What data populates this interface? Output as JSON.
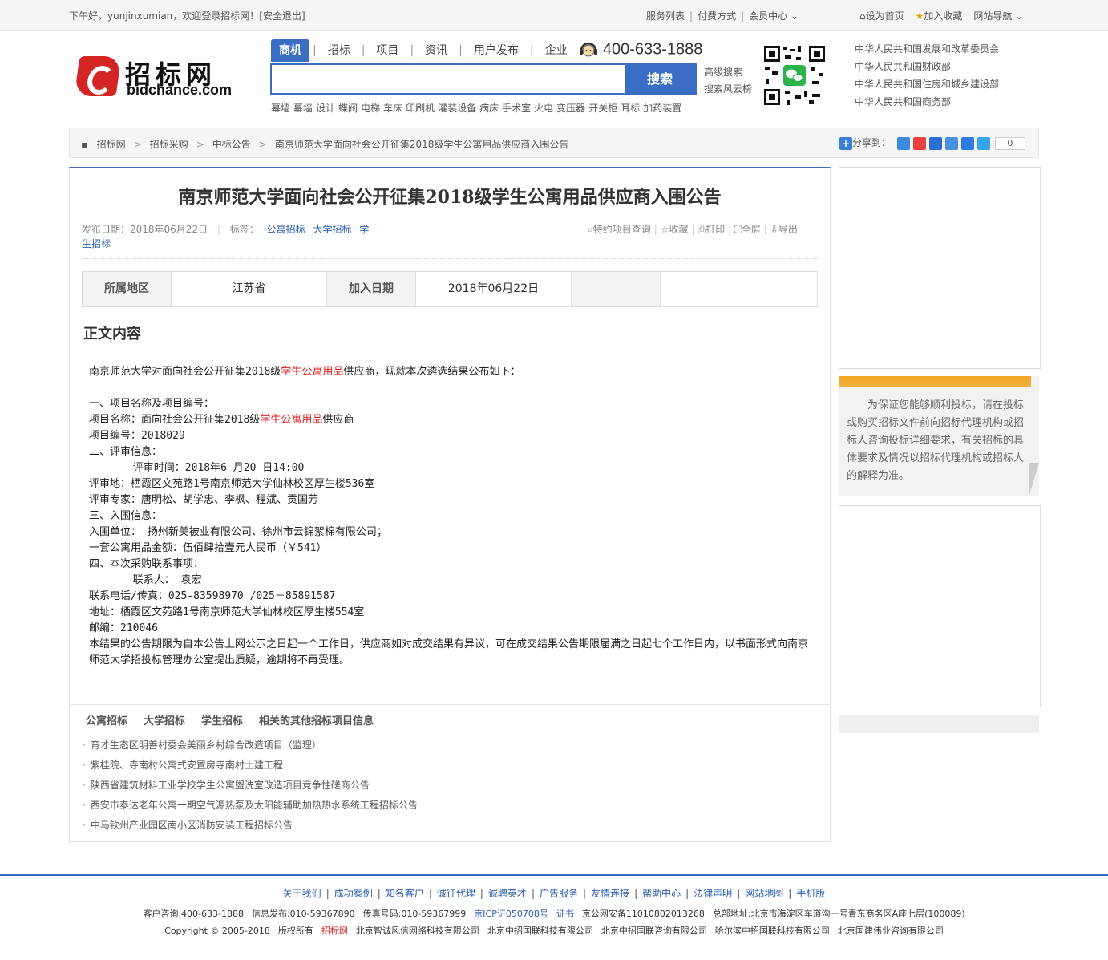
{
  "topbar": {
    "greeting": "下午好，yunjinxumian，欢迎登录招标网！[安全退出]",
    "service_list": "服务列表",
    "pay_method": "付费方式",
    "member_center": "会员中心",
    "set_home": "设为首页",
    "add_fav": "加入收藏",
    "site_nav": "网站导航"
  },
  "logo": {
    "cn": "招标网",
    "en": "bidchance.com"
  },
  "search": {
    "tabs": [
      "商机",
      "招标",
      "项目",
      "资讯",
      "用户发布",
      "企业"
    ],
    "active_tab": 0,
    "phone": "400-633-1888",
    "placeholder": "",
    "button": "搜索",
    "advanced": "高级搜索",
    "cloud": "搜索风云榜",
    "hotwords": [
      "幕墙",
      "幕墙",
      "设计",
      "蝶阀",
      "电梯",
      "车床",
      "印刷机",
      "灌装设备",
      "病床",
      "手术室",
      "火电",
      "变压器",
      "开关柜",
      "耳标",
      "加药装置"
    ]
  },
  "gov_links": [
    "中华人民共和国发展和改革委员会",
    "中华人民共和国财政部",
    "中华人民共和国住房和城乡建设部",
    "中华人民共和国商务部"
  ],
  "breadcrumb": {
    "items": [
      "招标网",
      "招标采购",
      "中标公告",
      "南京师范大学面向社会公开征集2018级学生公寓用品供应商入围公告"
    ],
    "share_label": "分享到：",
    "share_count": "0"
  },
  "article": {
    "title": "南京师范大学面向社会公开征集2018级学生公寓用品供应商入围公告",
    "publish_label": "发布日期：2018年06月22日",
    "tag_label": "标签：",
    "tags": [
      "公寓招标",
      "大学招标",
      "学生招标"
    ],
    "tools": [
      "特约项目查询",
      "收藏",
      "打印",
      "全屏",
      "导出"
    ],
    "info": {
      "region_label": "所属地区",
      "region": "江苏省",
      "date_label": "加入日期",
      "date": "2018年06月22日"
    },
    "section_title": "正文内容",
    "body": {
      "intro_a": "南京师范大学对面向社会公开征集2018级",
      "intro_hl": "学生公寓用品",
      "intro_b": "供应商，现就本次遴选结果公布如下：",
      "s1": "一、项目名称及项目编号：",
      "name_a": "项目名称：面向社会公开征集2018级",
      "name_hl": "学生公寓用品",
      "name_b": "供应商",
      "code": "项目编号：2018029",
      "s2": "二、评审信息：",
      "time": "       评审时间：2018年6 月20 日14:00",
      "place": "评审地：栖霞区文苑路1号南京师范大学仙林校区厚生楼536室",
      "experts": "评审专家：唐明松、胡学忠、李枫、程斌、贡国芳",
      "s3": "三、入围信息：",
      "units": "入围单位： 扬州新美被业有限公司、徐州市云锦絮棉有限公司；",
      "amount": "一套公寓用品金额：伍佰肆拾壹元人民币（￥541）",
      "s4": "四、本次采购联系事项：",
      "contact": "       联系人： 袁宏",
      "tel": "联系电话/传真：025-83598970 /025－85891587",
      "addr": "地址：栖霞区文苑路1号南京师范大学仙林校区厚生楼554室",
      "zip": "邮编：210046",
      "closing": "本结果的公告期限为自本公告上网公示之日起一个工作日，供应商如对成交结果有异议，可在成交结果公告期限届满之日起七个工作日内，以书面形式向南京师范大学招投标管理办公室提出质疑，逾期将不再受理。"
    }
  },
  "related": {
    "heads": [
      "公寓招标",
      "大学招标",
      "学生招标",
      "相关的其他招标项目信息"
    ],
    "items": [
      "育才生态区明善村委会美丽乡村综合改造项目（监理）",
      "紫桂院、寺南村公寓式安置房寺南村土建工程",
      "陕西省建筑材料工业学校学生公寓盥洗室改造项目竞争性磋商公告",
      "西安市泰达老年公寓一期空气源热泵及太阳能辅助加热热水系统工程招标公告",
      "中马钦州产业园区南小区消防安装工程招标公告"
    ]
  },
  "notice": "为保证您能够顺利投标，请在投标或购买招标文件前向招标代理机构或招标人咨询投标详细要求，有关招标的具体要求及情况以招标代理机构或招标人的解释为准。",
  "footer": {
    "links": [
      "关于我们",
      "成功案例",
      "知名客户",
      "诚征代理",
      "诚聘英才",
      "广告服务",
      "友情连接",
      "帮助中心",
      "法律声明",
      "网站地图",
      "手机版"
    ],
    "line1": [
      "客户咨询:400-633-1888",
      "信息发布:010-59367890",
      "传真号码:010-59367999",
      "京ICP证050708号",
      "证书",
      "京公网安备11010802013268",
      "总部地址:北京市海淀区车道沟一号青东商务区A座七层(100089)"
    ],
    "line2": [
      "Copyright © 2005-2018",
      "版权所有",
      "招标网",
      "北京智诚风信网络科技有限公司",
      "北京中招国联科技有限公司",
      "北京中招国联咨询有限公司",
      "哈尔滨中招国联科技有限公司",
      "北京国建伟业咨询有限公司"
    ]
  },
  "colors": {
    "accent": "#3a6ec4",
    "highlight": "#e02020",
    "logo": "#d42525",
    "notice_bar": "#f5a623"
  }
}
